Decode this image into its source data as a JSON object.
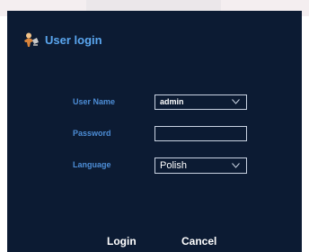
{
  "dialog": {
    "title": "User login",
    "title_icon": "user-login-icon",
    "accent_color": "#5aa6ef",
    "background_color": "#0c1b33"
  },
  "form": {
    "username_label": "User Name",
    "username_value": "admin",
    "password_label": "Password",
    "password_value": "",
    "language_label": "Language",
    "language_value": "Polish"
  },
  "buttons": {
    "login": "Login",
    "cancel": "Cancel"
  }
}
